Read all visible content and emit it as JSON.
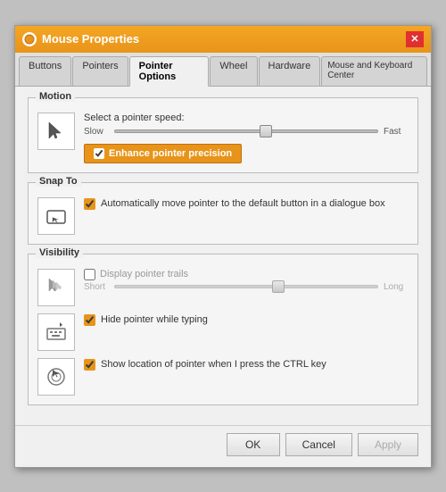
{
  "window": {
    "title": "Mouse Properties",
    "close_label": "✕"
  },
  "tabs": [
    {
      "id": "buttons",
      "label": "Buttons"
    },
    {
      "id": "pointers",
      "label": "Pointers"
    },
    {
      "id": "pointer-options",
      "label": "Pointer Options",
      "active": true
    },
    {
      "id": "wheel",
      "label": "Wheel"
    },
    {
      "id": "hardware",
      "label": "Hardware"
    },
    {
      "id": "mouse-keyboard",
      "label": "Mouse and Keyboard Center"
    }
  ],
  "sections": {
    "motion": {
      "title": "Motion",
      "speed_label": "Select a pointer speed:",
      "slow_label": "Slow",
      "fast_label": "Fast",
      "enhance_label": "Enhance pointer precision",
      "enhance_checked": true
    },
    "snap_to": {
      "title": "Snap To",
      "auto_move_label": "Automatically move pointer to the default button in a dialogue box",
      "auto_move_checked": true
    },
    "visibility": {
      "title": "Visibility",
      "trail_label": "Display pointer trails",
      "trail_checked": false,
      "short_label": "Short",
      "long_label": "Long",
      "hide_typing_label": "Hide pointer while typing",
      "hide_typing_checked": true,
      "show_ctrl_label": "Show location of pointer when I press the CTRL key",
      "show_ctrl_checked": true
    }
  },
  "buttons": {
    "ok_label": "OK",
    "cancel_label": "Cancel",
    "apply_label": "Apply"
  }
}
